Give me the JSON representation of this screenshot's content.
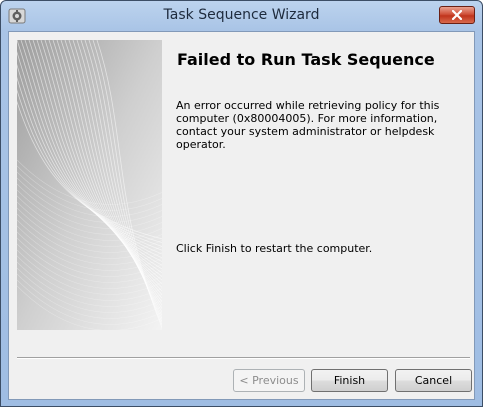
{
  "window": {
    "title": "Task Sequence Wizard",
    "close_icon": "close-icon"
  },
  "content": {
    "heading": "Failed to Run Task Sequence",
    "message": "An error occurred while retrieving policy for this computer (0x80004005). For more information, contact your system administrator or helpdesk operator.",
    "finish_note": "Click Finish to restart the computer."
  },
  "buttons": {
    "back": "< Previous",
    "finish": "Finish",
    "cancel": "Cancel"
  },
  "colors": {
    "title_bar": "#a9c4e6",
    "close_button": "#c0341c",
    "dialog_background": "#f0f0f0"
  }
}
